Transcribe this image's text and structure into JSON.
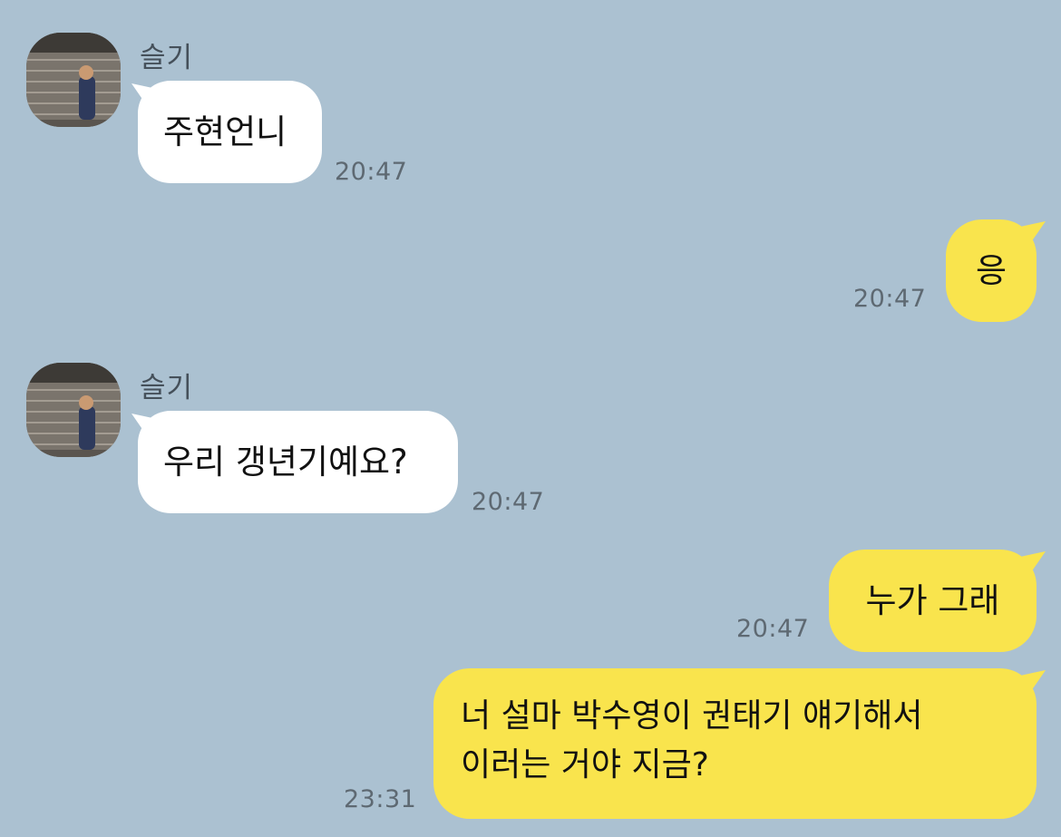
{
  "messages": [
    {
      "sender": "슬기",
      "text": "주현언니",
      "time": "20:47",
      "direction": "incoming"
    },
    {
      "text": "응",
      "time": "20:47",
      "direction": "outgoing"
    },
    {
      "sender": "슬기",
      "text": "우리 갱년기예요?",
      "time": "20:47",
      "direction": "incoming"
    },
    {
      "text": "누가 그래",
      "time": "20:47",
      "direction": "outgoing"
    },
    {
      "lines": [
        "너 설마 박수영이 권태기 얘기해서",
        "이러는 거야 지금?"
      ],
      "time": "23:31",
      "direction": "outgoing"
    }
  ],
  "colors": {
    "background": "#abc1d1",
    "incoming_bubble": "#ffffff",
    "outgoing_bubble": "#f9e44d",
    "timestamp": "#5e6972"
  }
}
